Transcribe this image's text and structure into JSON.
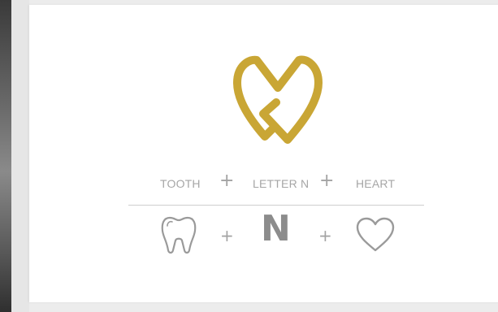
{
  "concept": {
    "parts": [
      "TOOTH",
      "LETTER N",
      "HEART"
    ],
    "operator": "+",
    "letter": "N"
  },
  "colors": {
    "logo_gold": "#c9a635",
    "gray": "#8c8c8c",
    "light_gray": "#a6a6a6"
  },
  "icons": {
    "logo": "tooth-heart-monogram-icon",
    "tooth": "tooth-icon",
    "heart": "heart-icon"
  }
}
